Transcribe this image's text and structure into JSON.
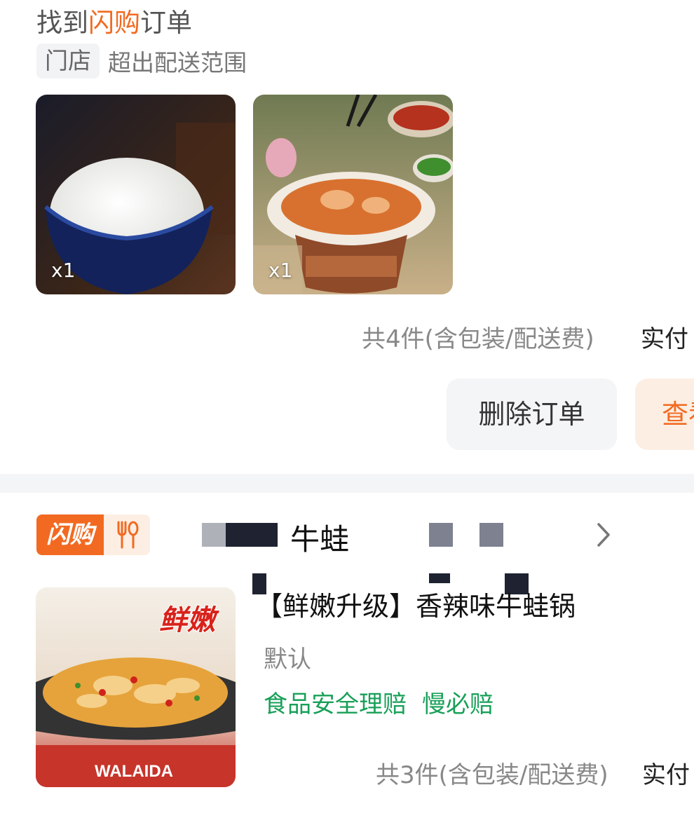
{
  "order1": {
    "hint_prefix": "找到",
    "hint_highlight": "闪购",
    "hint_suffix": "订单",
    "store_tag": "门店",
    "store_note": "超出配送范围",
    "items": [
      {
        "name": "rice",
        "qty": "x1"
      },
      {
        "name": "frog-pot",
        "qty": "x1"
      }
    ],
    "summary": "共4件(含包装/配送费)",
    "paid_label": "实付",
    "delete_button": "删除订单",
    "view_button": "查看"
  },
  "order2": {
    "badge_label": "闪购",
    "badge_icon": "fork-spoon-icon",
    "shop_name": "牛蛙",
    "item_title": "【鲜嫩升级】香辣味牛蛙锅",
    "spec": "默认",
    "guarantees": [
      "食品安全理赔",
      "慢必赔"
    ],
    "image_sticker": "鲜嫩",
    "image_brand": "WALAIDA",
    "summary": "共3件(含包装/配送费)",
    "paid_label": "实付"
  },
  "colors": {
    "accent": "#f26a21",
    "green": "#18a058"
  }
}
